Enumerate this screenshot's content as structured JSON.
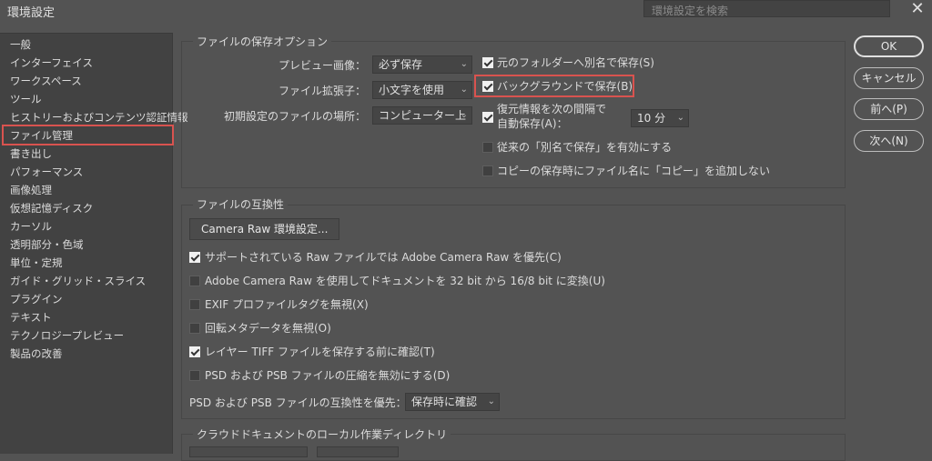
{
  "window": {
    "title": "環境設定",
    "search_placeholder": "環境設定を検索",
    "close_symbol": "✕"
  },
  "sidebar": {
    "items": [
      {
        "label": "一般"
      },
      {
        "label": "インターフェイス"
      },
      {
        "label": "ワークスペース"
      },
      {
        "label": "ツール"
      },
      {
        "label": "ヒストリーおよびコンテンツ認証情報"
      },
      {
        "label": "ファイル管理",
        "selected": true
      },
      {
        "label": "書き出し"
      },
      {
        "label": "パフォーマンス"
      },
      {
        "label": "画像処理"
      },
      {
        "label": "仮想記憶ディスク"
      },
      {
        "label": "カーソル"
      },
      {
        "label": "透明部分・色域"
      },
      {
        "label": "単位・定規"
      },
      {
        "label": "ガイド・グリッド・スライス"
      },
      {
        "label": "プラグイン"
      },
      {
        "label": "テキスト"
      },
      {
        "label": "テクノロジープレビュー"
      },
      {
        "label": "製品の改善"
      }
    ]
  },
  "save_options": {
    "title": "ファイルの保存オプション",
    "preview_label": "プレビュー画像：",
    "preview_value": "必ず保存",
    "ext_label": "ファイル拡張子：",
    "ext_value": "小文字を使用",
    "location_label": "初期設定のファイルの場所：",
    "location_value": "コンピューター上",
    "save_as_original": {
      "label": "元のフォルダーへ別名で保存(S)",
      "checked": true
    },
    "background_save": {
      "label": "バックグラウンドで保存(B)",
      "checked": true
    },
    "autosave": {
      "label_line1": "復元情報を次の間隔で",
      "label_line2": "自動保存(A)：",
      "checked": true,
      "interval": "10 分"
    },
    "legacy_save_as": {
      "label": "従来の「別名で保存」を有効にする",
      "checked": false
    },
    "copy_suffix": {
      "label": "コピーの保存時にファイル名に「コピー」を追加しない",
      "checked": false
    }
  },
  "compat": {
    "title": "ファイルの互換性",
    "camera_raw_button": "Camera Raw 環境設定...",
    "checks": [
      {
        "label": "サポートされている Raw ファイルでは Adobe Camera Raw を優先(C)",
        "checked": true
      },
      {
        "label": "Adobe Camera Raw を使用してドキュメントを 32 bit から 16/8 bit に変換(U)",
        "checked": false
      },
      {
        "label": "EXIF プロファイルタグを無視(X)",
        "checked": false
      },
      {
        "label": "回転メタデータを無視(O)",
        "checked": false
      },
      {
        "label": "レイヤー TIFF ファイルを保存する前に確認(T)",
        "checked": true
      },
      {
        "label": "PSD および PSB ファイルの圧縮を無効にする(D)",
        "checked": false
      }
    ],
    "psd_compat_label": "PSD および PSB ファイルの互換性を優先：",
    "psd_compat_value": "保存時に確認"
  },
  "cloud": {
    "title": "クラウドドキュメントのローカル作業ディレクトリ"
  },
  "buttons": {
    "ok": "OK",
    "cancel": "キャンセル",
    "prev": "前へ(P)",
    "next": "次へ(N)"
  },
  "colors": {
    "background": "#535353",
    "panel": "#424242",
    "highlight_red": "#d9534f",
    "check_on": "#f0f0f0"
  }
}
